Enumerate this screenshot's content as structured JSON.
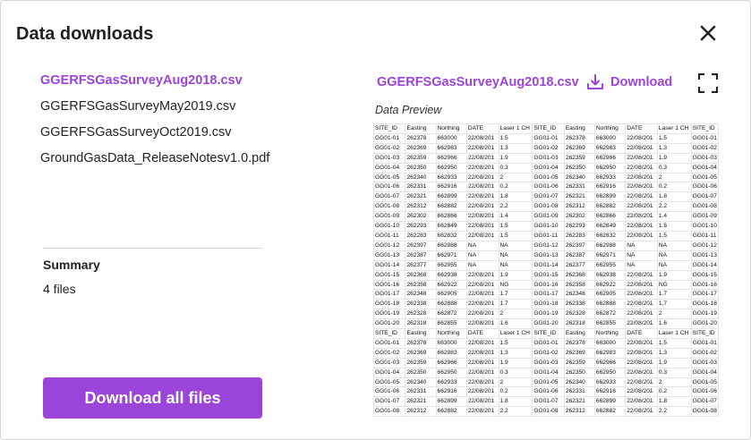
{
  "dialog": {
    "title": "Data downloads",
    "close_label": "Close"
  },
  "files": [
    {
      "name": "GGERFSGasSurveyAug2018.csv",
      "selected": true
    },
    {
      "name": "GGERFSGasSurveyMay2019.csv",
      "selected": false
    },
    {
      "name": "GGERFSGasSurveyOct2019.csv",
      "selected": false
    },
    {
      "name": "GroundGasData_ReleaseNotesv1.0.pdf",
      "selected": false
    }
  ],
  "summary": {
    "heading": "Summary",
    "value": "4 files"
  },
  "download_all_label": "Download all files",
  "preview": {
    "file_name": "GGERFSGasSurveyAug2018.csv",
    "download_label": "Download",
    "label": "Data Preview",
    "columns": [
      "SITE_ID",
      "Easting",
      "Northing",
      "DATE",
      "Laser 1 CH"
    ],
    "rows": [
      [
        "GG01-01",
        "262378",
        "663000",
        "22/08/201",
        "1.5"
      ],
      [
        "GG01-02",
        "262369",
        "662983",
        "22/08/201",
        "1.3"
      ],
      [
        "GG01-03",
        "262359",
        "662966",
        "22/08/201",
        "1.9"
      ],
      [
        "GG01-04",
        "262350",
        "662950",
        "22/08/201",
        "0.3"
      ],
      [
        "GG01-05",
        "262340",
        "662933",
        "22/08/201",
        "2"
      ],
      [
        "GG01-06",
        "262331",
        "662916",
        "22/08/201",
        "0.2"
      ],
      [
        "GG01-07",
        "262321",
        "662899",
        "22/08/201",
        "1.8"
      ],
      [
        "GG01-08",
        "262312",
        "662882",
        "22/08/201",
        "2.2"
      ],
      [
        "GG01-09",
        "262302",
        "662866",
        "22/08/201",
        "1.4"
      ],
      [
        "GG01-10",
        "262293",
        "662849",
        "22/08/201",
        "1.5"
      ],
      [
        "GG01-11",
        "262283",
        "662832",
        "22/08/201",
        "1.5"
      ],
      [
        "GG01-12",
        "262397",
        "662988",
        "NA",
        "NA"
      ],
      [
        "GG01-13",
        "262387",
        "662971",
        "NA",
        "NA"
      ],
      [
        "GG01-14",
        "262377",
        "662955",
        "NA",
        "NA"
      ],
      [
        "GG01-15",
        "262368",
        "662938",
        "22/08/201",
        "1.9"
      ],
      [
        "GG01-16",
        "262358",
        "662922",
        "22/08/201",
        "NG"
      ],
      [
        "GG01-17",
        "262348",
        "662905",
        "22/08/201",
        "1.7"
      ],
      [
        "GG01-18",
        "262338",
        "662888",
        "22/08/201",
        "1.7"
      ],
      [
        "GG01-19",
        "262328",
        "662872",
        "22/08/201",
        "2"
      ],
      [
        "GG01-20",
        "262318",
        "662855",
        "22/08/201",
        "1.6"
      ]
    ],
    "tail_rows": 8,
    "repeat_cols_visible": [
      "SITE_ID"
    ],
    "row_ids_third_block": [
      "SITE_ID",
      "GG01-01",
      "GG01-02",
      "GG01-03",
      "GG01-04",
      "GG01-05",
      "GG01-06",
      "GG01-07",
      "GG01-08",
      "GG01-09",
      "GG01-10",
      "GG01-11",
      "GG01-12",
      "GG01-13",
      "GG01-14",
      "GG01-15",
      "GG01-16",
      "GG01-17",
      "GG01-18",
      "GG01-19",
      "GG01-20"
    ]
  },
  "colors": {
    "accent": "#9b44d9",
    "text": "#222222",
    "divider": "#cfcfcf"
  },
  "icons": {
    "close": "close-icon",
    "download": "download-icon",
    "expand": "fullscreen-icon"
  }
}
